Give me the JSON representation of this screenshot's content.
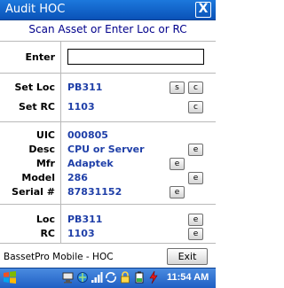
{
  "window": {
    "title": "Audit HOC",
    "close_glyph": "X"
  },
  "heading": "Scan Asset or Enter Loc or RC",
  "enter": {
    "label": "Enter",
    "value": "",
    "placeholder": ""
  },
  "set_loc": {
    "label": "Set Loc",
    "value": "PB311",
    "btn_s": "s",
    "btn_c": "c"
  },
  "set_rc": {
    "label": "Set RC",
    "value": "1103",
    "btn_c": "c"
  },
  "asset": {
    "uic": {
      "label": "UIC",
      "value": "000805"
    },
    "desc": {
      "label": "Desc",
      "value": "CPU or Server",
      "btn_e": "e"
    },
    "mfr": {
      "label": "Mfr",
      "value": "Adaptek",
      "btn_e": "e"
    },
    "model": {
      "label": "Model",
      "value": "286",
      "btn_e": "e"
    },
    "serial": {
      "label": "Serial #",
      "value": "87831152",
      "btn_e": "e"
    }
  },
  "location": {
    "loc": {
      "label": "Loc",
      "value": "PB311",
      "btn_e": "e"
    },
    "rc": {
      "label": "RC",
      "value": "1103",
      "btn_e": "e"
    }
  },
  "footer": {
    "app_name": "BassetPro Mobile - HOC",
    "exit_label": "Exit"
  },
  "taskbar": {
    "clock": "11:54 AM",
    "icons": [
      "windows-start-icon",
      "network-icon",
      "connectivity-icon",
      "signal-icon",
      "sync-icon",
      "battery-icon",
      "power-icon"
    ]
  },
  "colors": {
    "titlebar": "#0a52b8",
    "heading": "#00008b",
    "value": "#1f3fa8",
    "taskbar": "#1f5fc3"
  }
}
